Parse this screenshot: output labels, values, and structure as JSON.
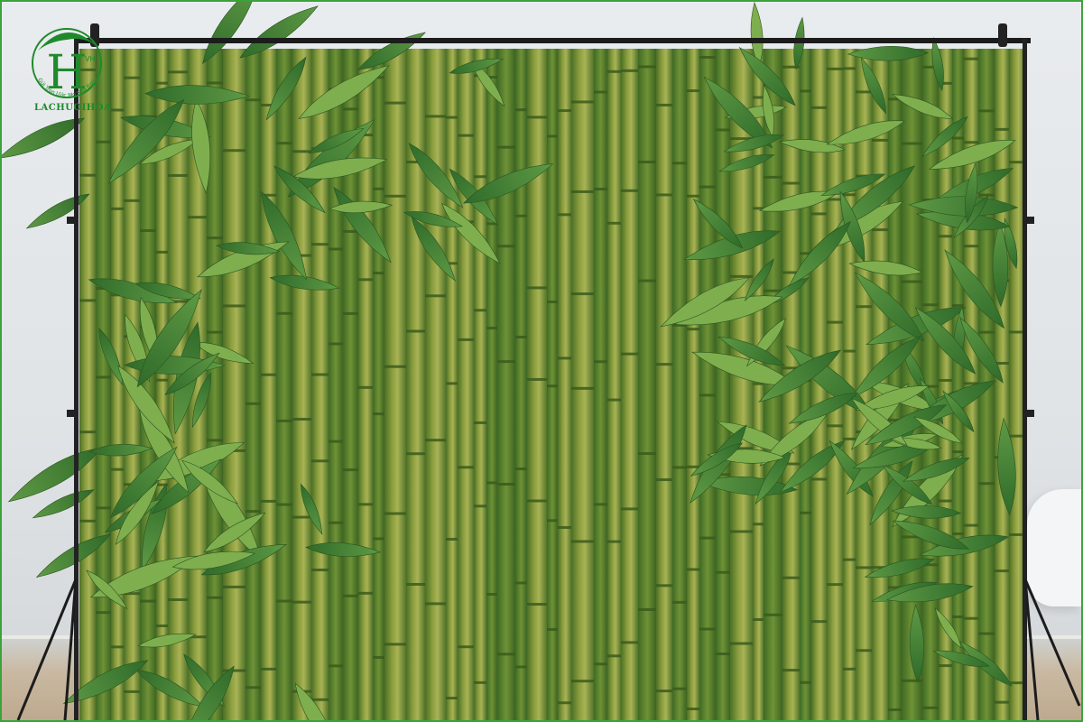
{
  "image": {
    "subject": "bamboo backdrop on stand",
    "watermark": {
      "monogram": "H",
      "small_mark": "VH",
      "arc_text": "Gửi Trọn Ước Mơ Nhà Bạn",
      "brand": "LACHUOIHOA"
    },
    "colors": {
      "wall": "#e3e6e8",
      "bamboo_dark": "#4f7a2c",
      "bamboo_light": "#b8bf5e",
      "leaf": "#3f7d32",
      "frame_border": "#3aa33a"
    }
  }
}
